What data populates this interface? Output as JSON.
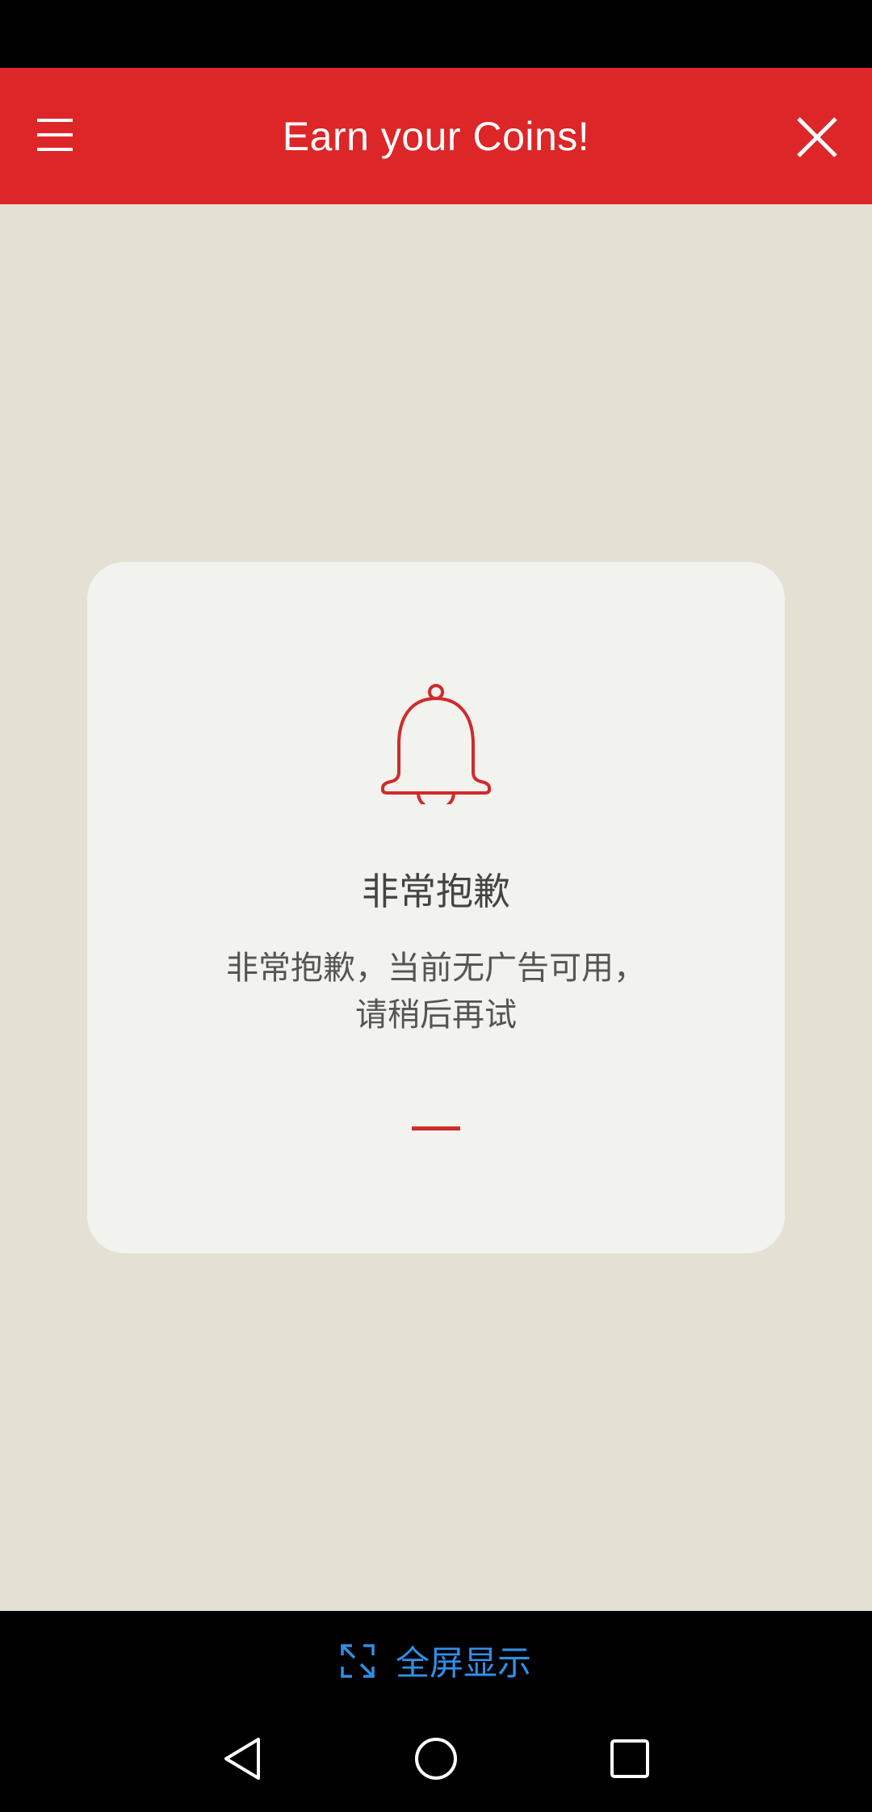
{
  "app_bar": {
    "title": "Earn your Coins!",
    "menu_icon": "hamburger-menu-icon",
    "close_icon": "close-icon",
    "color": "#dd2628"
  },
  "card": {
    "icon": "bell-icon",
    "title": "非常抱歉",
    "message_line1": "非常抱歉，当前无广告可用，",
    "message_line2": "请稍后再试",
    "accent": "#d22a2a"
  },
  "fullscreen": {
    "icon": "expand-icon",
    "label": "全屏显示",
    "color": "#2f90e8"
  },
  "nav": {
    "back_icon": "back-triangle-icon",
    "home_icon": "home-circle-icon",
    "recents_icon": "recents-square-icon"
  }
}
